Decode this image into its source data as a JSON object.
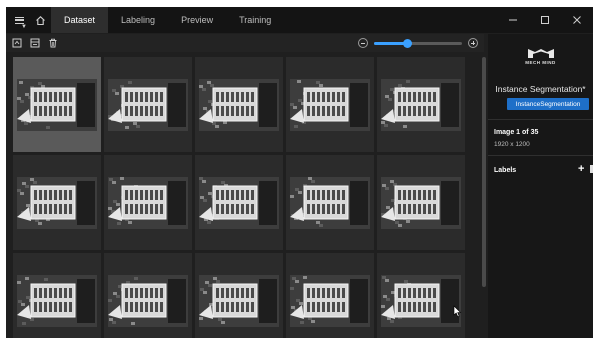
{
  "titlebar": {
    "tabs": [
      {
        "label": "Dataset",
        "active": true
      },
      {
        "label": "Labeling",
        "active": false
      },
      {
        "label": "Preview",
        "active": false
      },
      {
        "label": "Training",
        "active": false
      }
    ],
    "menu_icon": "hamburger-menu-icon",
    "home_icon": "home-icon",
    "window_controls": [
      "minimize-icon",
      "maximize-icon",
      "close-icon"
    ]
  },
  "toolbar": {
    "icons": [
      "import-image-icon",
      "import-folder-icon",
      "delete-icon"
    ],
    "zoom": {
      "level": 0.38,
      "minus_icon": "zoom-out-icon",
      "plus_icon": "zoom-in-icon"
    }
  },
  "grid": {
    "columns": 5,
    "rows": 3,
    "selected_index": 0,
    "image_count_visible": 15
  },
  "panel": {
    "logo_text": "MECH MIND",
    "project_name": "Instance Segmentation*",
    "project_type": "InstanceSegmentation",
    "image_index": "Image 1 of 35",
    "image_size": "1920 x 1200",
    "labels_title": "Labels",
    "add_label": "+"
  },
  "colors": {
    "accent": "#3aa0ff",
    "badge": "#1e6fc8",
    "background": "#1f1f1f",
    "titlebar": "#141414"
  }
}
